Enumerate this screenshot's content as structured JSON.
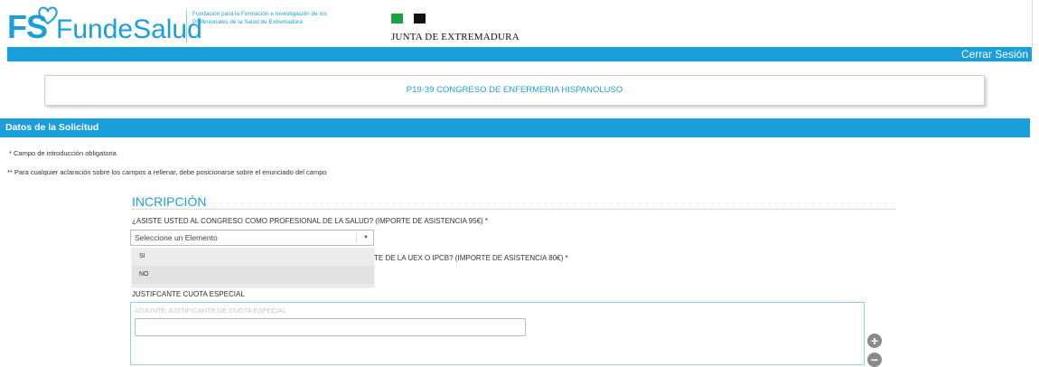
{
  "header": {
    "logo_fs": "FS",
    "logo_name": "FundeSalud",
    "logo_subtitle": "Fundación para la Formación e Investigación de los Profesionales de la Salud de Extremadura",
    "junta_text": "JUNTA DE EXTREMADURA",
    "colors": {
      "brand_blue": "#1b9fdb",
      "junta_green": "#19a340"
    }
  },
  "topbar": {
    "logout_label": "Cerrar Sesión"
  },
  "event": {
    "title": "P19-39 CONGRESO DE ENFERMERIA HISPANOLUSO"
  },
  "section": {
    "title": "Datos de la Solicitud"
  },
  "notes": {
    "required": "* Campo de introducción obligatoria",
    "help": "** Para cualquier aclaración sobre los campos a rellenar, debe posicionarse sobre el enunciado del campo"
  },
  "form": {
    "heading": "INCRIPCIÓN",
    "q1_label": "¿ASISTE USTED AL CONGRESO COMO PROFESIONAL DE LA SALUD? (IMPORTE DE ASISTENCIA 95€) *",
    "q1_select_value": "Seleccione un Elemento",
    "q1_options": [
      "SI",
      "NO"
    ],
    "q2_label_visible": "TE DE LA UEX O IPCB? (IMPORTE DE ASISTENCIA 80€) *",
    "justificante_label": "JUSTIFCANTE CUOTA ESPECIAL",
    "attach_placeholder": "ADJUNTE JUSTIFICANTE DE CUOTA ESPECIAL",
    "attach_count": "1",
    "add_icon": "plus-icon",
    "remove_icon": "minus-icon"
  }
}
